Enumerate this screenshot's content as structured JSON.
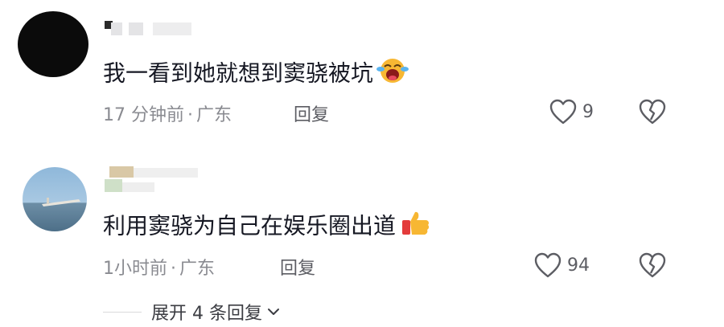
{
  "comments": [
    {
      "text": "我一看到她就想到窦骁被坑",
      "emoji": "laughing-crying-emoji",
      "time": "17 分钟前",
      "location": "广东",
      "separator": "·",
      "reply_label": "回复",
      "likes": "9"
    },
    {
      "text": "利用窦骁为自己在娱乐圈出道",
      "emoji": "thumbs-up-emoji",
      "time": "1小时前",
      "location": "广东",
      "separator": "·",
      "reply_label": "回复",
      "likes": "94"
    }
  ],
  "expand_replies": {
    "label": "展开 4 条回复"
  },
  "colors": {
    "text": "#161823",
    "meta": "#8a8b91",
    "icon": "#5c5d63"
  }
}
